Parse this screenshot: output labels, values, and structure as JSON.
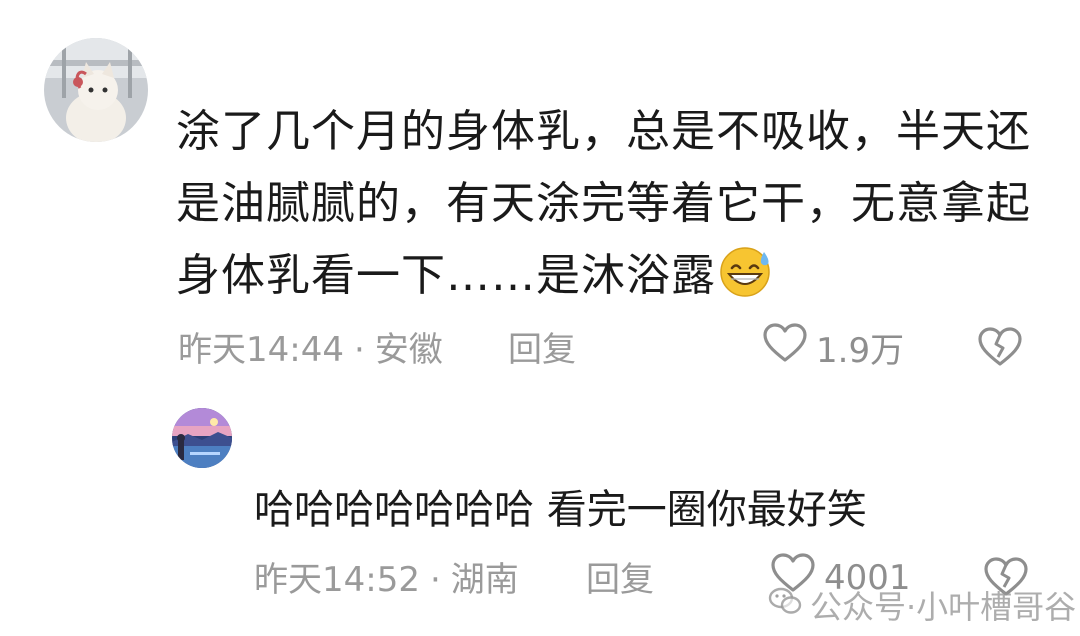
{
  "comment": {
    "text": "涂了几个月的身体乳，总是不吸收，半天还是油腻腻的，有天涂完等着它干，无意拿起身体乳看一下……是沐浴露",
    "emoji": "grinning-sweat-emoji",
    "time": "昨天14:44",
    "separator": "·",
    "location": "安徽",
    "reply_label": "回复",
    "likes": "1.9万"
  },
  "reply": {
    "text": "哈哈哈哈哈哈哈 看完一圈你最好笑",
    "time": "昨天14:52",
    "separator": "·",
    "location": "湖南",
    "reply_label": "回复",
    "likes": "4001"
  },
  "watermark": {
    "text": "公众号·小叶槽哥谷"
  },
  "icons": {
    "like": "heart-outline-icon",
    "dislike": "broken-heart-icon"
  },
  "colors": {
    "text_primary": "#1a1a1a",
    "text_meta": "#9a9a9a",
    "icon_gray": "#8e8e8e"
  }
}
